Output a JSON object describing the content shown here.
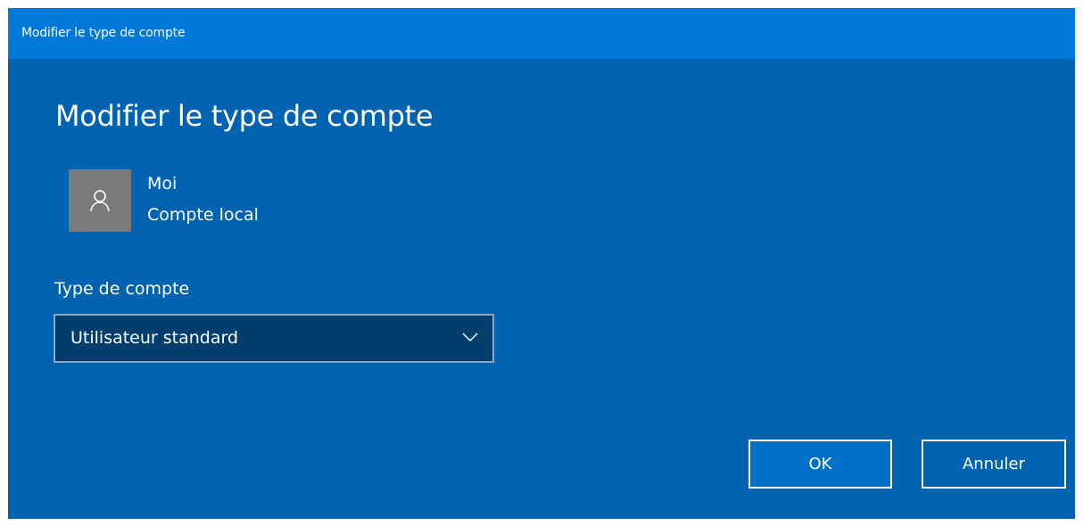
{
  "window": {
    "title": "Modifier le type de compte"
  },
  "dialog": {
    "heading": "Modifier le type de compte",
    "user": {
      "name": "Moi",
      "account_type": "Compte local",
      "avatar_icon": "person-icon"
    },
    "account_type_field": {
      "label": "Type de compte",
      "selected_value": "Utilisateur standard",
      "dropdown_icon": "chevron-down-icon"
    },
    "buttons": {
      "ok_label": "OK",
      "cancel_label": "Annuler"
    }
  },
  "colors": {
    "titlebar": "#0078d7",
    "background": "#0063b1",
    "select_background": "#003e6e",
    "avatar_background": "#7a7a7a",
    "text": "#ffffff"
  }
}
